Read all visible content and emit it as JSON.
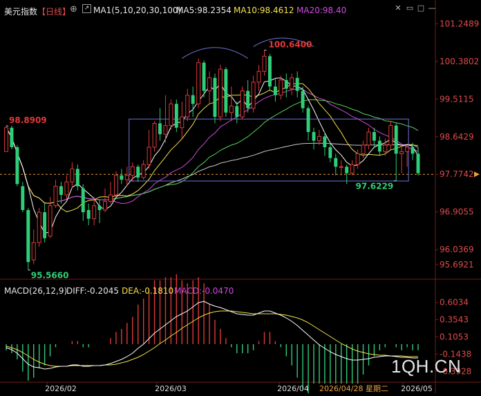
{
  "header": {
    "title": "美元指数",
    "period": "【日线】",
    "ma_label": "MA1(5,10,20,30,100)",
    "ma5": "MA5:98.2354",
    "ma10": "MA10:98.4612",
    "ma20": "MA20:98.40"
  },
  "macd_header": {
    "label": "MACD(26,12,9)",
    "diff": "DIFF:-0.2045",
    "dea": "DEA:-0.1810",
    "macd": "MACD:-0.0470"
  },
  "watermark": "1QH.CN",
  "colors": {
    "background": "#000000",
    "up": "#e03a3a",
    "down": "#2fcf79",
    "ma5": "#ffffff",
    "ma10": "#f7e34a",
    "ma20": "#d14be0",
    "ma30": "#5ad35a",
    "ma100": "#c8c8c8",
    "axis_text": "#e04a4a",
    "box": "#6f73d9"
  },
  "chart_data": [
    {
      "type": "candlestick",
      "title": "美元指数 日线",
      "y_ticks": [
        "101.2489",
        "100.3802",
        "99.5115",
        "98.6429",
        "97.7742",
        "96.9055",
        "96.0369",
        "95.6921"
      ],
      "ylim": [
        95.45,
        101.35
      ],
      "current_price": 97.7742,
      "x_ticks": [
        "2026/02",
        "2026/03",
        "2026/04",
        "2026/05"
      ],
      "cursor_date": "2026/04/28 星期二",
      "annotations": [
        {
          "label": "98.8909",
          "price": 98.8909
        },
        {
          "label": "95.5660",
          "price": 95.566
        },
        {
          "label": "100.6400",
          "price": 100.64
        },
        {
          "label": "97.6229",
          "price": 97.6229
        }
      ],
      "candles": [
        [
          98.3,
          98.85,
          98.3,
          98.9
        ],
        [
          98.85,
          98.4,
          98.35,
          98.9
        ],
        [
          98.4,
          97.55,
          97.5,
          98.45
        ],
        [
          97.5,
          96.95,
          96.9,
          97.6
        ],
        [
          96.95,
          95.75,
          95.57,
          97.0
        ],
        [
          95.8,
          96.2,
          95.7,
          96.5
        ],
        [
          96.2,
          96.9,
          96.1,
          97.0
        ],
        [
          96.9,
          96.3,
          96.2,
          97.1
        ],
        [
          96.35,
          97.05,
          96.3,
          97.25
        ],
        [
          97.05,
          97.5,
          97.0,
          97.65
        ],
        [
          97.5,
          97.3,
          97.1,
          97.6
        ],
        [
          97.3,
          97.6,
          97.2,
          97.75
        ],
        [
          97.6,
          97.9,
          97.45,
          98.05
        ],
        [
          97.9,
          97.5,
          97.4,
          98.0
        ],
        [
          97.45,
          96.9,
          96.7,
          97.55
        ],
        [
          96.95,
          96.75,
          96.6,
          97.1
        ],
        [
          96.75,
          97.05,
          96.6,
          97.25
        ],
        [
          97.05,
          96.95,
          96.65,
          97.2
        ],
        [
          96.95,
          97.15,
          96.9,
          97.45
        ],
        [
          97.15,
          97.3,
          97.1,
          97.6
        ],
        [
          97.3,
          97.75,
          97.25,
          97.85
        ],
        [
          97.75,
          97.65,
          97.55,
          97.9
        ],
        [
          97.65,
          97.75,
          97.5,
          97.95
        ],
        [
          97.75,
          97.95,
          97.6,
          98.05
        ],
        [
          97.95,
          97.7,
          97.6,
          98.0
        ],
        [
          97.7,
          98.0,
          97.65,
          98.1
        ],
        [
          98.0,
          98.4,
          97.9,
          98.8
        ],
        [
          98.4,
          98.95,
          98.3,
          99.0
        ],
        [
          98.95,
          98.7,
          98.55,
          99.3
        ],
        [
          98.7,
          98.9,
          98.5,
          99.6
        ],
        [
          98.9,
          99.4,
          98.8,
          99.5
        ],
        [
          99.4,
          98.85,
          98.75,
          99.5
        ],
        [
          98.85,
          99.1,
          98.6,
          99.45
        ],
        [
          99.1,
          99.6,
          99.0,
          99.75
        ],
        [
          99.6,
          99.4,
          99.1,
          99.8
        ],
        [
          99.4,
          100.35,
          99.3,
          100.45
        ],
        [
          100.35,
          99.7,
          99.55,
          100.4
        ],
        [
          99.7,
          100.0,
          99.4,
          100.15
        ],
        [
          100.0,
          99.1,
          98.95,
          100.1
        ],
        [
          99.1,
          100.2,
          99.0,
          100.3
        ],
        [
          100.2,
          99.2,
          99.1,
          100.25
        ],
        [
          99.2,
          99.35,
          99.0,
          99.8
        ],
        [
          99.35,
          99.1,
          98.95,
          99.45
        ],
        [
          99.1,
          99.7,
          99.05,
          99.8
        ],
        [
          99.7,
          99.3,
          99.2,
          99.95
        ],
        [
          99.3,
          99.9,
          99.2,
          100.05
        ],
        [
          99.9,
          100.15,
          99.7,
          100.3
        ],
        [
          100.15,
          100.5,
          100.05,
          100.64
        ],
        [
          100.5,
          99.8,
          99.7,
          100.55
        ],
        [
          99.8,
          99.6,
          99.45,
          100.0
        ],
        [
          99.6,
          99.95,
          99.5,
          100.05
        ],
        [
          99.95,
          99.75,
          99.55,
          100.1
        ],
        [
          99.75,
          100.0,
          99.6,
          100.1
        ],
        [
          100.0,
          99.7,
          99.55,
          100.15
        ],
        [
          99.7,
          99.3,
          99.2,
          99.8
        ],
        [
          99.3,
          98.75,
          98.55,
          99.35
        ],
        [
          98.75,
          98.55,
          98.35,
          98.85
        ],
        [
          98.55,
          98.65,
          98.45,
          98.8
        ],
        [
          98.65,
          98.4,
          98.2,
          98.75
        ],
        [
          98.4,
          98.15,
          98.05,
          98.5
        ],
        [
          98.15,
          97.95,
          97.75,
          98.25
        ],
        [
          97.95,
          97.95,
          97.75,
          98.1
        ],
        [
          97.95,
          97.8,
          97.55,
          98.0
        ],
        [
          97.8,
          98.0,
          97.75,
          98.1
        ],
        [
          98.0,
          98.25,
          97.9,
          98.35
        ],
        [
          98.25,
          98.45,
          98.15,
          98.55
        ],
        [
          98.45,
          98.75,
          98.35,
          98.85
        ],
        [
          98.75,
          98.55,
          98.4,
          98.85
        ],
        [
          98.55,
          98.3,
          98.2,
          98.65
        ],
        [
          98.3,
          98.45,
          98.2,
          98.6
        ],
        [
          98.45,
          98.9,
          98.35,
          99.0
        ],
        [
          98.9,
          98.25,
          97.62,
          98.95
        ],
        [
          98.25,
          98.3,
          97.8,
          98.45
        ],
        [
          98.3,
          98.4,
          97.95,
          98.45
        ],
        [
          98.4,
          98.25,
          98.1,
          98.5
        ],
        [
          98.25,
          97.8,
          97.75,
          98.4
        ]
      ]
    },
    {
      "type": "macd",
      "y_ticks": [
        "0.6034",
        "0.3543",
        "0.1053",
        "-0.1438",
        "-0.3928"
      ],
      "ylim": [
        -0.5,
        0.7
      ],
      "diff": [
        -0.05,
        -0.08,
        -0.13,
        -0.21,
        -0.29,
        -0.33,
        -0.34,
        -0.36,
        -0.35,
        -0.33,
        -0.32,
        -0.32,
        -0.3,
        -0.3,
        -0.32,
        -0.32,
        -0.31,
        -0.31,
        -0.3,
        -0.28,
        -0.25,
        -0.22,
        -0.18,
        -0.13,
        -0.06,
        0.0,
        0.08,
        0.16,
        0.22,
        0.28,
        0.34,
        0.4,
        0.44,
        0.48,
        0.54,
        0.6,
        0.62,
        0.58,
        0.55,
        0.53,
        0.5,
        0.47,
        0.44,
        0.43,
        0.42,
        0.42,
        0.45,
        0.48,
        0.48,
        0.45,
        0.42,
        0.38,
        0.33,
        0.27,
        0.2,
        0.13,
        0.06,
        -0.01,
        -0.06,
        -0.11,
        -0.15,
        -0.18,
        -0.21,
        -0.23,
        -0.23,
        -0.22,
        -0.21,
        -0.19,
        -0.18,
        -0.17,
        -0.17,
        -0.18,
        -0.19,
        -0.19,
        -0.2,
        -0.2
      ],
      "dea": [
        -0.03,
        -0.05,
        -0.08,
        -0.12,
        -0.17,
        -0.22,
        -0.26,
        -0.29,
        -0.31,
        -0.32,
        -0.32,
        -0.32,
        -0.31,
        -0.31,
        -0.31,
        -0.31,
        -0.31,
        -0.31,
        -0.3,
        -0.3,
        -0.29,
        -0.27,
        -0.25,
        -0.22,
        -0.19,
        -0.15,
        -0.1,
        -0.05,
        0.01,
        0.06,
        0.12,
        0.17,
        0.23,
        0.28,
        0.33,
        0.38,
        0.42,
        0.45,
        0.47,
        0.48,
        0.48,
        0.48,
        0.47,
        0.46,
        0.45,
        0.44,
        0.44,
        0.44,
        0.44,
        0.44,
        0.43,
        0.42,
        0.4,
        0.38,
        0.35,
        0.31,
        0.26,
        0.21,
        0.16,
        0.11,
        0.06,
        0.01,
        -0.03,
        -0.07,
        -0.1,
        -0.12,
        -0.14,
        -0.15,
        -0.16,
        -0.16,
        -0.17,
        -0.17,
        -0.17,
        -0.18,
        -0.18,
        -0.18
      ]
    }
  ]
}
